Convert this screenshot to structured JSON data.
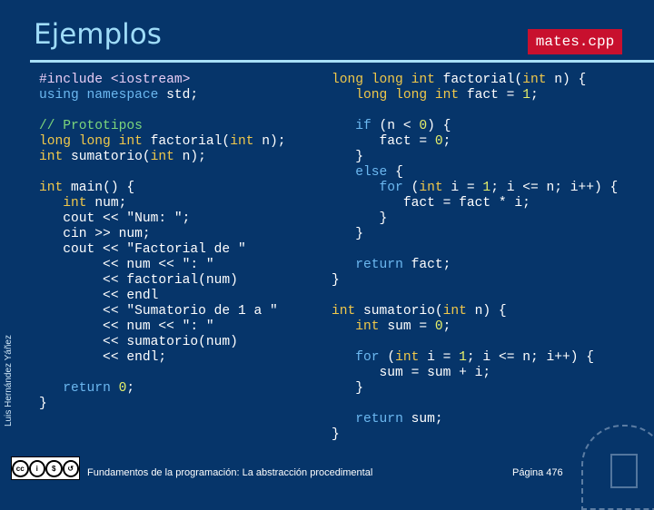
{
  "title": "Ejemplos",
  "filename": "mates.cpp",
  "author": "Luis Hernández Yáñez",
  "footer": "Fundamentos de la programación: La abstracción procedimental",
  "page": "Página 476",
  "license_icons": [
    "cc",
    "by",
    "nc",
    "sa"
  ],
  "colors": {
    "background": "#06356a",
    "title": "#9fdcf8",
    "file_badge": "#c8102e",
    "type": "#f0c84a",
    "keyword": "#6cb8f0",
    "number": "#e6f06a",
    "comment": "#7cd67c"
  },
  "code_left": [
    [
      [
        "#include <iostream>",
        "p"
      ]
    ],
    [
      [
        "using namespace",
        "k"
      ],
      [
        " std;",
        ""
      ]
    ],
    [],
    [
      [
        "// Prototipos",
        "c"
      ]
    ],
    [
      [
        "long long int",
        "t"
      ],
      [
        " factorial(",
        ""
      ],
      [
        "int",
        "t"
      ],
      [
        " n);",
        ""
      ]
    ],
    [
      [
        "int",
        "t"
      ],
      [
        " sumatorio(",
        ""
      ],
      [
        "int",
        "t"
      ],
      [
        " n);",
        ""
      ]
    ],
    [],
    [
      [
        "int",
        "t"
      ],
      [
        " main() {",
        ""
      ]
    ],
    [
      [
        "   ",
        ""
      ],
      [
        "int",
        "t"
      ],
      [
        " num;",
        ""
      ]
    ],
    [
      [
        "   cout << \"Num: \";",
        ""
      ]
    ],
    [
      [
        "   cin >> num;",
        ""
      ]
    ],
    [
      [
        "   cout << \"Factorial de \"",
        ""
      ]
    ],
    [
      [
        "        << num << \": \"",
        ""
      ]
    ],
    [
      [
        "        << factorial(num)",
        ""
      ]
    ],
    [
      [
        "        << endl",
        ""
      ]
    ],
    [
      [
        "        << \"Sumatorio de 1 a \"",
        ""
      ]
    ],
    [
      [
        "        << num << \": \"",
        ""
      ]
    ],
    [
      [
        "        << sumatorio(num)",
        ""
      ]
    ],
    [
      [
        "        << endl;",
        ""
      ]
    ],
    [],
    [
      [
        "   ",
        ""
      ],
      [
        "return",
        "k"
      ],
      [
        " ",
        ""
      ],
      [
        "0",
        "n"
      ],
      [
        ";",
        ""
      ]
    ],
    [
      [
        "}",
        ""
      ]
    ]
  ],
  "code_right": [
    [
      [
        "long long int",
        "t"
      ],
      [
        " factorial(",
        ""
      ],
      [
        "int",
        "t"
      ],
      [
        " n) {",
        ""
      ]
    ],
    [
      [
        "   ",
        ""
      ],
      [
        "long long int",
        "t"
      ],
      [
        " fact = ",
        ""
      ],
      [
        "1",
        "n"
      ],
      [
        ";",
        ""
      ]
    ],
    [],
    [
      [
        "   ",
        ""
      ],
      [
        "if",
        "k"
      ],
      [
        " (n < ",
        ""
      ],
      [
        "0",
        "n"
      ],
      [
        ") {",
        ""
      ]
    ],
    [
      [
        "      fact = ",
        ""
      ],
      [
        "0",
        "n"
      ],
      [
        ";",
        ""
      ]
    ],
    [
      [
        "   }",
        ""
      ]
    ],
    [
      [
        "   ",
        ""
      ],
      [
        "else",
        "k"
      ],
      [
        " {",
        ""
      ]
    ],
    [
      [
        "      ",
        ""
      ],
      [
        "for",
        "k"
      ],
      [
        " (",
        ""
      ],
      [
        "int",
        "t"
      ],
      [
        " i = ",
        ""
      ],
      [
        "1",
        "n"
      ],
      [
        "; i <= n; i++) {",
        ""
      ]
    ],
    [
      [
        "         fact = fact * i;",
        ""
      ]
    ],
    [
      [
        "      }",
        ""
      ]
    ],
    [
      [
        "   }",
        ""
      ]
    ],
    [],
    [
      [
        "   ",
        ""
      ],
      [
        "return",
        "k"
      ],
      [
        " fact;",
        ""
      ]
    ],
    [
      [
        "}",
        ""
      ]
    ],
    [],
    [
      [
        "int",
        "t"
      ],
      [
        " sumatorio(",
        ""
      ],
      [
        "int",
        "t"
      ],
      [
        " n) {",
        ""
      ]
    ],
    [
      [
        "   ",
        ""
      ],
      [
        "int",
        "t"
      ],
      [
        " sum = ",
        ""
      ],
      [
        "0",
        "n"
      ],
      [
        ";",
        ""
      ]
    ],
    [],
    [
      [
        "   ",
        ""
      ],
      [
        "for",
        "k"
      ],
      [
        " (",
        ""
      ],
      [
        "int",
        "t"
      ],
      [
        " i = ",
        ""
      ],
      [
        "1",
        "n"
      ],
      [
        "; i <= n; i++) {",
        ""
      ]
    ],
    [
      [
        "      sum = sum + i;",
        ""
      ]
    ],
    [
      [
        "   }",
        ""
      ]
    ],
    [],
    [
      [
        "   ",
        ""
      ],
      [
        "return",
        "k"
      ],
      [
        " sum;",
        ""
      ]
    ],
    [
      [
        "}",
        ""
      ]
    ]
  ]
}
